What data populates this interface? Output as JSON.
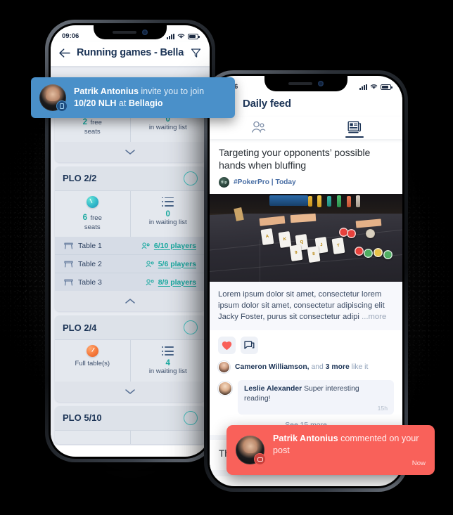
{
  "left_phone": {
    "status": {
      "time": "09:06",
      "signal_icon": "cellular-bars-icon",
      "wifi_icon": "wifi-icon",
      "battery_icon": "battery-icon"
    },
    "appbar": {
      "back_icon": "back-arrow-icon",
      "title": "Running games - Bellagio La...",
      "filter_icon": "filter-funnel-icon"
    },
    "invite_toast": {
      "user": "Patrik Antonius",
      "action": " invite you to join ",
      "game": "10/20 NLH",
      "at": " at ",
      "venue": "Bellagio",
      "badge_icon": "card-badge-icon",
      "avatar_icon": "user-avatar",
      "color": "#4a90c9"
    },
    "games": [
      {
        "name": "",
        "partial_top": true,
        "free_seats_num": "2",
        "free_seats_label": "free",
        "free_seats_label2": "seats",
        "waiting_num": "0",
        "waiting_label": "in waiting list",
        "collapse_icon": "chevron-down-icon",
        "expanded": false,
        "tables": []
      },
      {
        "name": "PLO 2/2",
        "free_seats_num": "6",
        "free_seats_label": "free",
        "free_seats_label2": "seats",
        "waiting_num": "0",
        "waiting_label": "in waiting list",
        "gauge": "teal",
        "collapse_icon": "chevron-up-icon",
        "expanded": true,
        "tables": [
          {
            "table_icon": "table-icon",
            "name": "Table 1",
            "players_icon": "players-icon",
            "players": "6/10 players"
          },
          {
            "table_icon": "table-icon",
            "name": "Table 2",
            "players_icon": "players-icon",
            "players": "5/6 players"
          },
          {
            "table_icon": "table-icon",
            "name": "Table 3",
            "players_icon": "players-icon",
            "players": "8/9 players"
          }
        ]
      },
      {
        "name": "PLO 2/4",
        "full_label": "Full table(s)",
        "waiting_num": "4",
        "waiting_label": "in waiting list",
        "gauge": "red",
        "collapse_icon": "chevron-down-icon",
        "expanded": false,
        "tables": []
      },
      {
        "name": "PLO 5/10",
        "partial_bottom": true,
        "tables": []
      }
    ],
    "accent_teal": "#1aa9a0",
    "ring_color": "#48c4c4"
  },
  "right_phone": {
    "status": {
      "time": "09:06",
      "signal_icon": "cellular-bars-icon",
      "wifi_icon": "wifi-icon",
      "battery_icon": "battery-icon"
    },
    "appbar": {
      "menu_icon": "hamburger-menu-icon",
      "title": "Daily feed"
    },
    "tabs": [
      {
        "icon": "people-icon",
        "name": "people-tab",
        "active": false
      },
      {
        "icon": "news-icon",
        "name": "news-tab",
        "active": true
      }
    ],
    "post": {
      "title": "Targeting your opponents’ possible hands when bluffing",
      "logo_icon": "pokerpro-logo-icon",
      "logo_text": "fl·p",
      "meta": "#PokerPro | Today",
      "image_alt": "poker-table-photo",
      "excerpt": "Lorem ipsum dolor sit amet, consectetur lorem ipsum dolor sit amet, consectetur adipiscing elit Jacky Foster, purus sit consectetur adipi",
      "more_label": " ...more",
      "actions": [
        {
          "icon": "heart-icon",
          "name": "like-button",
          "color": "#f9615a"
        },
        {
          "icon": "comment-icon",
          "name": "comment-button",
          "color": "#1d3557"
        }
      ],
      "likes": {
        "user": "Cameron Williamson,",
        "and": " and ",
        "count": "3 more",
        "suffix": " like it"
      },
      "comment": {
        "user": "Leslie Alexander",
        "text": " Super interesting reading!",
        "time": "15h"
      },
      "see_more": "See 15 more"
    },
    "next_post_preview": "The",
    "toast": {
      "user": "Patrik Antonius",
      "action": " commented on your post",
      "time": "Now",
      "badge_icon": "comment-badge-icon",
      "avatar_icon": "user-avatar",
      "color": "#f9615a"
    }
  }
}
